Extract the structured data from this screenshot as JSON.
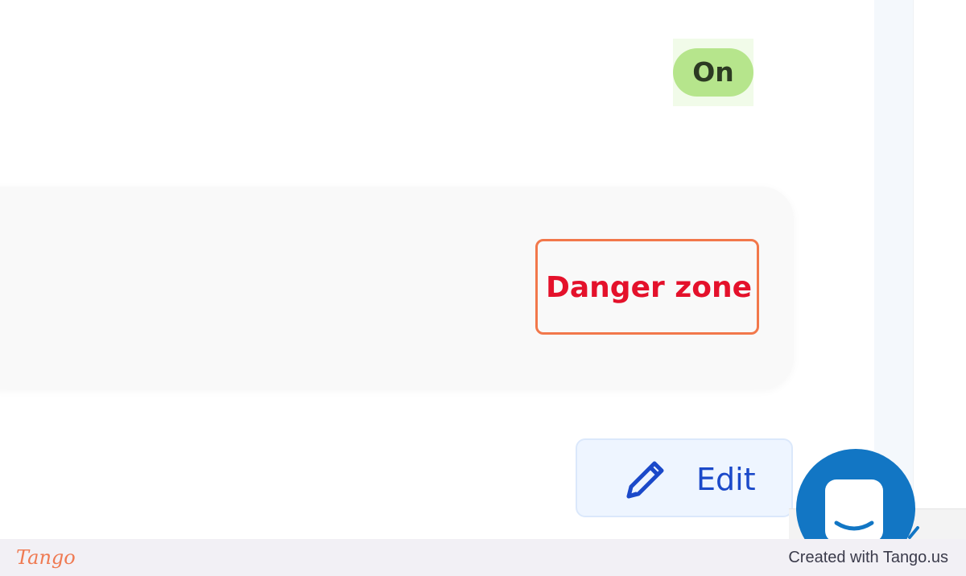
{
  "status": {
    "badge_label": "On",
    "badge_color": "#b6e58c"
  },
  "card": {
    "danger_link_label": "Danger zone",
    "danger_color": "#e4112b",
    "highlight_color": "#f2784b"
  },
  "actions": {
    "edit_label": "Edit",
    "edit_icon": "pencil-icon",
    "accent_color": "#1b49c9"
  },
  "chat": {
    "icon": "chat-icon",
    "color": "#1276c4"
  },
  "footer": {
    "logo_text": "Tango",
    "credit_text": "Created with Tango.us"
  }
}
